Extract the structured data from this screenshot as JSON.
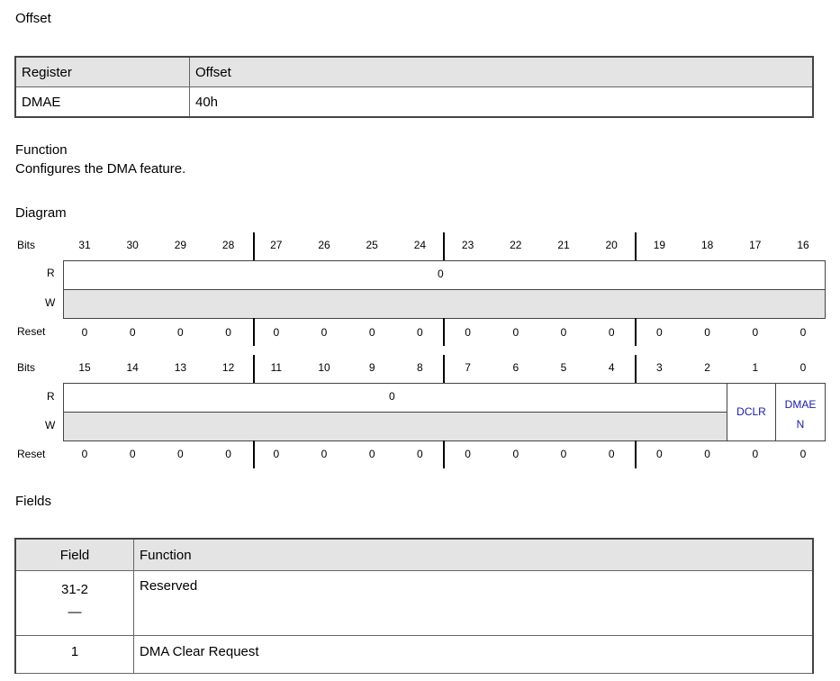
{
  "offset_heading": "Offset",
  "offset_table": {
    "headers": [
      "Register",
      "Offset"
    ],
    "row": [
      "DMAE",
      "40h"
    ]
  },
  "function_heading": "Function",
  "function_text": "Configures the DMA feature.",
  "diagram_heading": "Diagram",
  "diagram": {
    "bits_label": "Bits",
    "r_label": "R",
    "w_label": "W",
    "reset_label": "Reset",
    "upper_bits": [
      "31",
      "30",
      "29",
      "28",
      "27",
      "26",
      "25",
      "24",
      "23",
      "22",
      "21",
      "20",
      "19",
      "18",
      "17",
      "16"
    ],
    "upper_reset": [
      "0",
      "0",
      "0",
      "0",
      "0",
      "0",
      "0",
      "0",
      "0",
      "0",
      "0",
      "0",
      "0",
      "0",
      "0",
      "0"
    ],
    "upper_r_value": "0",
    "lower_bits": [
      "15",
      "14",
      "13",
      "12",
      "11",
      "10",
      "9",
      "8",
      "7",
      "6",
      "5",
      "4",
      "3",
      "2",
      "1",
      "0"
    ],
    "lower_reset": [
      "0",
      "0",
      "0",
      "0",
      "0",
      "0",
      "0",
      "0",
      "0",
      "0",
      "0",
      "0",
      "0",
      "0",
      "0",
      "0"
    ],
    "lower_r_value": "0",
    "field_dclr": "DCLR",
    "field_dmaen_line1": "DMAE",
    "field_dmaen_line2": "N"
  },
  "fields_heading": "Fields",
  "fields_table": {
    "headers": [
      "Field",
      "Function"
    ],
    "rows": [
      {
        "field": "31-2",
        "sub": "—",
        "function": "Reserved"
      },
      {
        "field": "1",
        "function": "DMA Clear Request"
      }
    ]
  }
}
